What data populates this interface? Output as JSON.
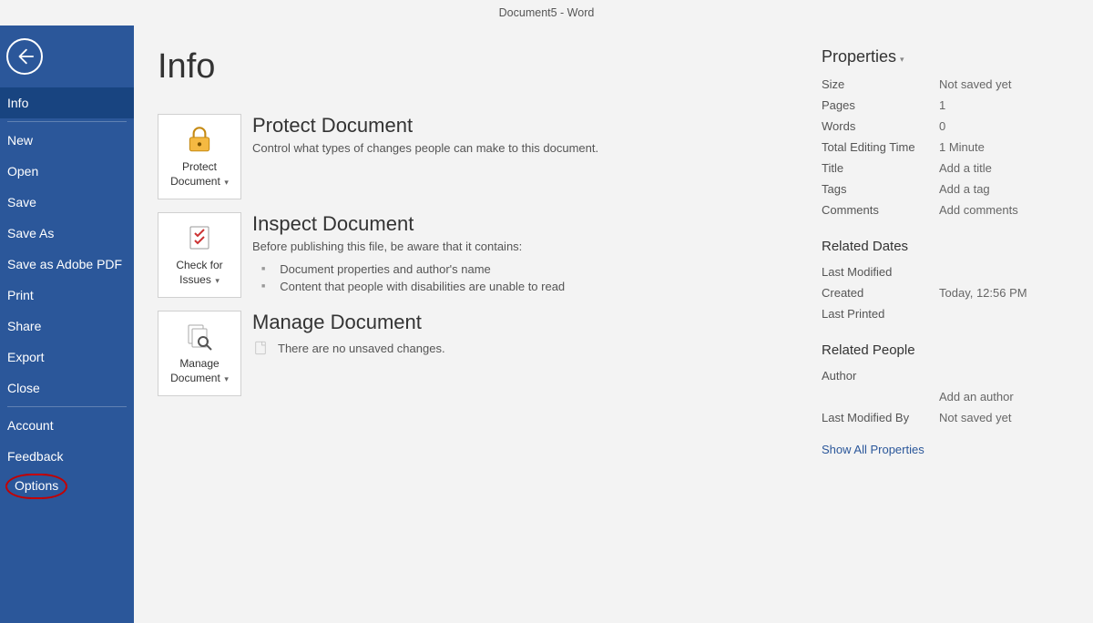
{
  "titlebar": "Document5  -  Word",
  "sidebar": {
    "items": [
      "Info",
      "New",
      "Open",
      "Save",
      "Save As",
      "Save as Adobe PDF",
      "Print",
      "Share",
      "Export",
      "Close"
    ],
    "items2": [
      "Account",
      "Feedback",
      "Options"
    ]
  },
  "page": {
    "title": "Info"
  },
  "protect": {
    "button": "Protect Document",
    "title": "Protect Document",
    "desc": "Control what types of changes people can make to this document."
  },
  "inspect": {
    "button": "Check for Issues",
    "title": "Inspect Document",
    "desc": "Before publishing this file, be aware that it contains:",
    "bullets": [
      "Document properties and author's name",
      "Content that people with disabilities are unable to read"
    ]
  },
  "manage": {
    "button": "Manage Document",
    "title": "Manage Document",
    "unsaved": "There are no unsaved changes."
  },
  "props": {
    "heading": "Properties",
    "rows": {
      "size_l": "Size",
      "size_v": "Not saved yet",
      "pages_l": "Pages",
      "pages_v": "1",
      "words_l": "Words",
      "words_v": "0",
      "tet_l": "Total Editing Time",
      "tet_v": "1 Minute",
      "title_l": "Title",
      "title_v": "Add a title",
      "tags_l": "Tags",
      "tags_v": "Add a tag",
      "comments_l": "Comments",
      "comments_v": "Add comments"
    },
    "dates_heading": "Related Dates",
    "dates": {
      "lm_l": "Last Modified",
      "lm_v": "",
      "cr_l": "Created",
      "cr_v": "Today, 12:56 PM",
      "lp_l": "Last Printed",
      "lp_v": ""
    },
    "people_heading": "Related People",
    "people": {
      "author_l": "Author",
      "author_add": "Add an author",
      "lmb_l": "Last Modified By",
      "lmb_v": "Not saved yet"
    },
    "showall": "Show All Properties"
  }
}
